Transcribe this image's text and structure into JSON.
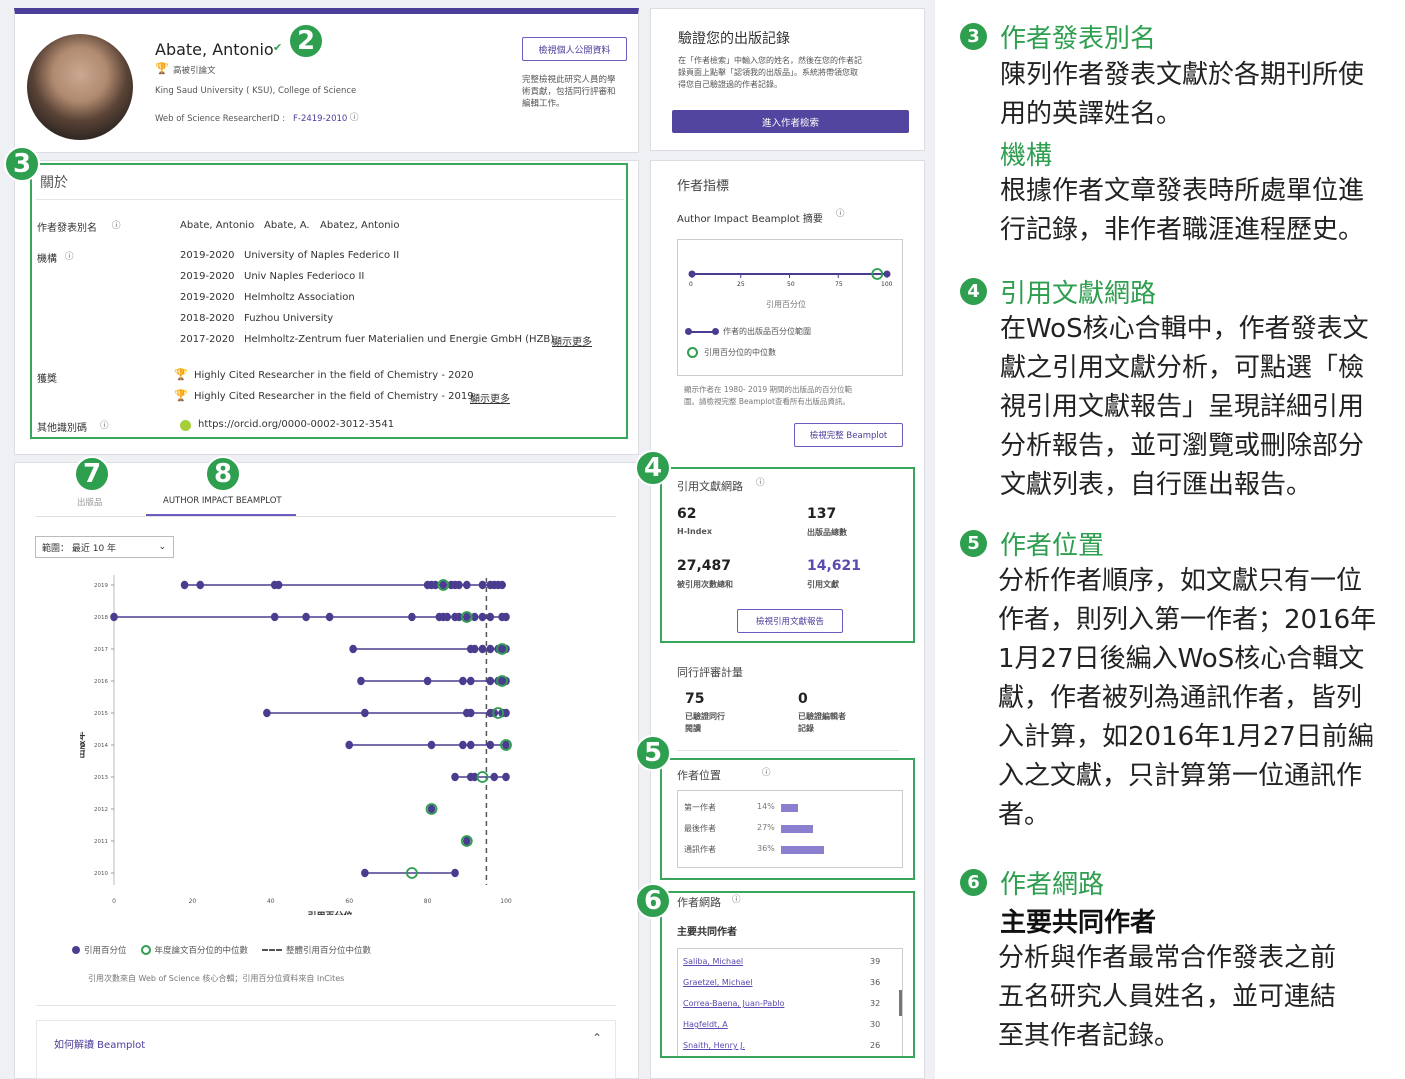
{
  "profile": {
    "name": "Abate, Antonio",
    "badge_label": "高被引論文",
    "institution": "King Saud University ( KSU), College of Science",
    "rid_label": "Web of Science ResearcherID :",
    "rid_value": "F-2419-2010",
    "view_public_button": "檢視個人公開資料",
    "view_public_note_1": "完整檢視此研究人員的學",
    "view_public_note_2": "術貢獻，包括同行評審和",
    "view_public_note_3": "編輯工作。"
  },
  "verify": {
    "title": "驗證您的出版記錄",
    "desc_1": "在「作者檢索」中輸入您的姓名，然後在您的作者記",
    "desc_2": "錄頁面上點擊「認領我的出版品」。系統將帶領您取",
    "desc_3": "得您自己驗證過的作者記錄。",
    "button": "進入作者檢索"
  },
  "about": {
    "title": "關於",
    "alias_label": "作者發表別名",
    "aliases": [
      "Abate, Antonio",
      "Abate, A.",
      "Abatez, Antonio"
    ],
    "org_label": "機構",
    "orgs": [
      {
        "years": "2019-2020",
        "name": "University of Naples Federico II"
      },
      {
        "years": "2019-2020",
        "name": "Univ Naples Federioco II"
      },
      {
        "years": "2019-2020",
        "name": "Helmholtz Association"
      },
      {
        "years": "2018-2020",
        "name": "Fuzhou University"
      },
      {
        "years": "2017-2020",
        "name": "Helmholtz-Zentrum fuer Materialien und Energie GmbH (HZB)"
      }
    ],
    "show_more": "顯示更多",
    "award_label": "獲獎",
    "awards": [
      "Highly Cited Researcher in the field of Chemistry - 2020",
      "Highly Cited Researcher in the field of Chemistry - 2019"
    ],
    "other_id_label": "其他識別碼",
    "orcid": "https://orcid.org/0000-0002-3012-3541"
  },
  "tabs": {
    "publications": "出版品",
    "beamplot": "AUTHOR IMPACT BEAMPLOT"
  },
  "range_select": "範圍： 最近 10 年",
  "badges": {
    "b2": "2",
    "b3": "3",
    "b4": "4",
    "b5": "5",
    "b6": "6",
    "b7": "7",
    "b8": "8"
  },
  "chart_data": {
    "type": "scatter",
    "xlabel": "引用百分位",
    "ylabel": "出版年",
    "xlim": [
      0,
      100
    ],
    "x_ticks": [
      "0",
      "20",
      "40",
      "60",
      "80",
      "100"
    ],
    "years": [
      "2019",
      "2018",
      "2017",
      "2016",
      "2015",
      "2014",
      "2013",
      "2012",
      "2011",
      "2010"
    ],
    "series": [
      {
        "year": "2019",
        "points": [
          18,
          22,
          41,
          42,
          80,
          81,
          82,
          84,
          86,
          87,
          88,
          90,
          94,
          96,
          97,
          98,
          99
        ],
        "median": 84,
        "range": [
          18,
          100
        ]
      },
      {
        "year": "2018",
        "points": [
          0,
          41,
          49,
          55,
          76,
          83,
          84,
          85,
          87,
          88,
          90,
          92,
          94,
          96,
          99,
          100
        ],
        "median": 90,
        "range": [
          0,
          100
        ]
      },
      {
        "year": "2017",
        "points": [
          61,
          91,
          92,
          94,
          96,
          98,
          99,
          100
        ],
        "median": 99,
        "range": [
          61,
          100
        ]
      },
      {
        "year": "2016",
        "points": [
          63,
          80,
          89,
          91,
          96,
          98,
          99,
          100
        ],
        "median": 99,
        "range": [
          63,
          100
        ]
      },
      {
        "year": "2015",
        "points": [
          39,
          64,
          90,
          91,
          96,
          97,
          99,
          100
        ],
        "median": 98,
        "range": [
          39,
          100
        ]
      },
      {
        "year": "2014",
        "points": [
          60,
          81,
          89,
          91,
          96,
          100
        ],
        "median": 100,
        "range": [
          60,
          100
        ]
      },
      {
        "year": "2013",
        "points": [
          87,
          91,
          92,
          97,
          100
        ],
        "median": 94,
        "range": [
          87,
          100
        ]
      },
      {
        "year": "2012",
        "points": [
          81
        ],
        "median": 81,
        "range": [
          81,
          81
        ]
      },
      {
        "year": "2011",
        "points": [
          90
        ],
        "median": 90,
        "range": [
          90,
          90
        ]
      },
      {
        "year": "2010",
        "points": [
          64,
          87
        ],
        "median": 76,
        "range": [
          64,
          87
        ]
      }
    ],
    "overall_median": 95
  },
  "legend": {
    "dot": "引用百分位",
    "circle": "年度論文百分位的中位數",
    "dash": "整體引用百分位中位數",
    "source": "引用次數來自 Web of Science 核心合輯；引用百分位資料來自 InCites"
  },
  "how_to": "如何解讀 Beamplot",
  "metrics": {
    "title": "作者指標",
    "summary_label": "Author Impact Beamplot 摘要",
    "ticks": [
      "0",
      "25",
      "50",
      "75",
      "100"
    ],
    "axis_label": "引用百分位",
    "legend_range": "作者的出版品百分位範圍",
    "legend_median": "引用百分位的中位數",
    "range_start": 0,
    "range_end": 100,
    "median": 95,
    "note_1": "顯示作者在 1980- 2019 期間的出版品的百分位範",
    "note_2": "圍。請檢視完整 Beamplot查看所有出版品資訊。",
    "button": "檢視完整 Beamplot"
  },
  "citation_network": {
    "title": "引用文獻網路",
    "h_index": "62",
    "h_index_label": "H-Index",
    "pubs": "137",
    "pubs_label": "出版品總數",
    "cited": "27,487",
    "cited_label": "被引用次數總和",
    "citing": "14,621",
    "citing_label": "引用文獻",
    "button": "檢視引用文獻報告"
  },
  "peer_review": {
    "title": "同行評審計量",
    "verified": "75",
    "verified_label_1": "已驗證同行",
    "verified_label_2": "閱讀",
    "editor": "0",
    "editor_label_1": "已驗證編輯者",
    "editor_label_2": "記錄"
  },
  "positions": {
    "title": "作者位置",
    "rows": [
      {
        "label": "第一作者",
        "pct": "14%",
        "value": 14
      },
      {
        "label": "最後作者",
        "pct": "27%",
        "value": 27
      },
      {
        "label": "通訊作者",
        "pct": "36%",
        "value": 36
      }
    ]
  },
  "coauthors": {
    "title": "作者網路",
    "subtitle": "主要共同作者",
    "rows": [
      {
        "name": "Saliba, Michael",
        "count": "39"
      },
      {
        "name": "Graetzel, Michael",
        "count": "36"
      },
      {
        "name": "Correa-Baena, Juan-Pablo",
        "count": "32"
      },
      {
        "name": "Hagfeldt, A",
        "count": "30"
      },
      {
        "name": "Snaith, Henry J.",
        "count": "26"
      }
    ]
  },
  "explain": {
    "s3_num": "3",
    "s3_head": "作者發表別名",
    "s3_body_1": "陳列作者發表文獻於各期刊所使",
    "s3_body_2": "用的英譯姓名。",
    "s3_head2": "機構",
    "s3_body_3": "根據作者文章發表時所處單位進",
    "s3_body_4": "行記錄，非作者職涯進程歷史。",
    "s4_num": "4",
    "s4_head": "引用文獻網路",
    "s4_body": [
      "在WoS核心合輯中，作者發表文",
      "獻之引用文獻分析，可點選「檢",
      "視引用文獻報告」呈現詳細引用",
      "分析報告，並可瀏覽或刪除部分",
      "文獻列表，自行匯出報告。"
    ],
    "s5_num": "5",
    "s5_head": "作者位置",
    "s5_body": [
      "分析作者順序，如文獻只有一位",
      "作者，則列入第一作者；2016年",
      "1月27日後編入WoS核心合輯文",
      "獻，作者被列為通訊作者，皆列",
      "入計算，如2016年1月27日前編",
      "入之文獻，只計算第一位通訊作",
      "者。"
    ],
    "s6_num": "6",
    "s6_head": "作者網路",
    "s6_sub": "主要共同作者",
    "s6_body": [
      "分析與作者最常合作發表之前",
      "五名研究人員姓名，並可連結",
      "至其作者記錄。"
    ]
  }
}
